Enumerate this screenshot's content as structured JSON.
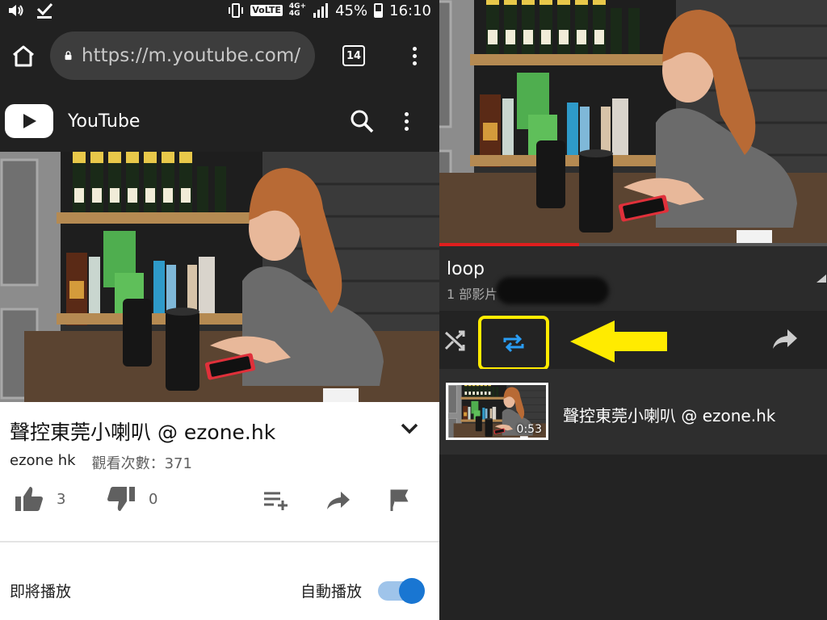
{
  "status_bar": {
    "network_badge": "VoLTE",
    "net_4g_top": "4G+",
    "net_4g_bottom": "4G",
    "battery": "45%",
    "time": "16:10"
  },
  "browser": {
    "url": "https://m.youtube.com/",
    "tab_count": "14"
  },
  "youtube_header": {
    "brand": "YouTube"
  },
  "video": {
    "title": "聲控東莞小喇叭 @ ezone.hk",
    "channel": "ezone hk",
    "views": "觀看次數：371",
    "likes": "3",
    "dislikes": "0",
    "progress": 0.36
  },
  "up_next": {
    "label": "即將播放",
    "autoplay_label": "自動播放",
    "autoplay_on": true
  },
  "playlist": {
    "title": "loop",
    "count": "1 部影片",
    "items": [
      {
        "title": "聲控東莞小喇叭 @ ezone.hk",
        "duration": "0:53"
      }
    ]
  },
  "colors": {
    "highlight": "#ffeb00",
    "loop_active": "#2a9df4",
    "progress": "#e01e1e",
    "toggle": "#1976d2"
  }
}
